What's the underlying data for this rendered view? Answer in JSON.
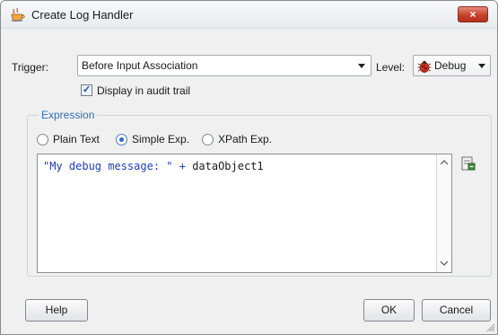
{
  "window": {
    "title": "Create Log Handler",
    "close_label": "×"
  },
  "trigger": {
    "label": "Trigger:",
    "value": "Before Input Association"
  },
  "level": {
    "label": "Level:",
    "value": "Debug",
    "icon": "bug-icon"
  },
  "audit": {
    "label": "Display in audit trail",
    "checked": true
  },
  "expression": {
    "group_label": "Expression",
    "options": [
      "Plain Text",
      "Simple Exp.",
      "XPath Exp."
    ],
    "selected": "Simple Exp.",
    "code_string": "\"My debug message: \"",
    "code_operator": " + ",
    "code_identifier": "dataObject1"
  },
  "buttons": {
    "help": "Help",
    "ok": "OK",
    "cancel": "Cancel"
  },
  "colors": {
    "accent": "#2f6fb5",
    "close_red": "#c7412b"
  }
}
